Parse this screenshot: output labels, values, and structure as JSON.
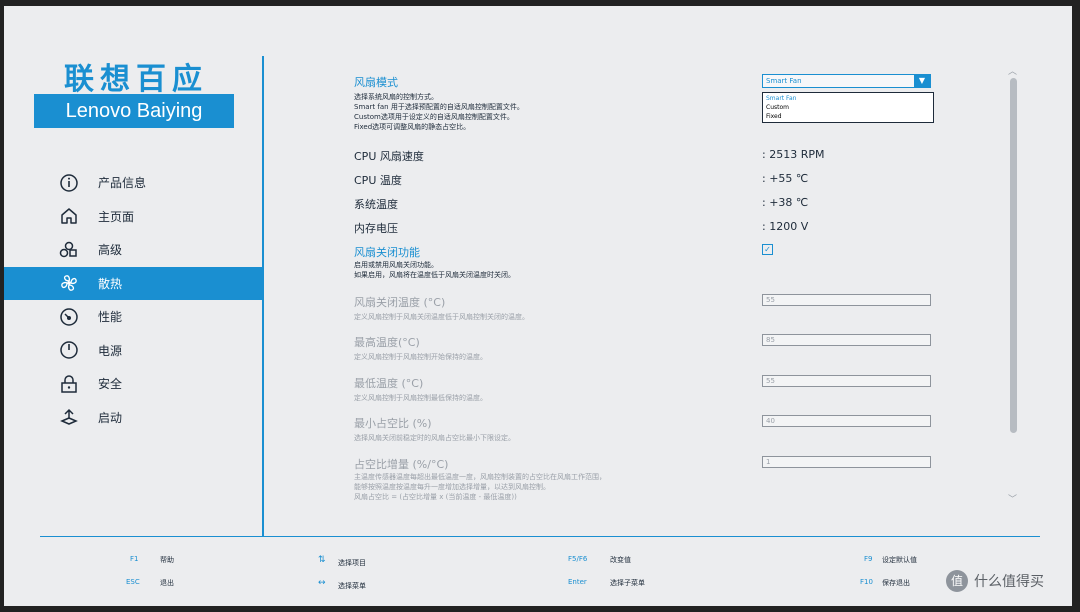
{
  "brand": {
    "cn": "联想百应",
    "en": "Lenovo Baiying"
  },
  "sidebar": {
    "items": [
      {
        "label": "产品信息",
        "icon": "info-icon"
      },
      {
        "label": "主页面",
        "icon": "home-icon"
      },
      {
        "label": "高级",
        "icon": "advanced-icon"
      },
      {
        "label": "散热",
        "icon": "fan-icon",
        "active": true
      },
      {
        "label": "性能",
        "icon": "performance-icon"
      },
      {
        "label": "电源",
        "icon": "power-icon"
      },
      {
        "label": "安全",
        "icon": "lock-icon"
      },
      {
        "label": "启动",
        "icon": "boot-icon"
      }
    ]
  },
  "main": {
    "fan_mode": {
      "label": "风扇模式",
      "desc": [
        "选择系统风扇的控制方式。",
        "Smart fan 用于选择预配置的自适风扇控制配置文件。",
        "Custom选项用于设定义的自适风扇控制配置文件。",
        "Fixed选项可调整风扇的静态占空比。"
      ],
      "selected": "Smart Fan",
      "options": [
        "Smart Fan",
        "Custom",
        "Fixed"
      ]
    },
    "cpu_fan_speed": {
      "label": "CPU 风扇速度",
      "value": ": 2513 RPM"
    },
    "cpu_temp": {
      "label": "CPU 温度",
      "value": ": +55 ℃"
    },
    "sys_temp": {
      "label": "系统温度",
      "value": ": +38 ℃"
    },
    "mem_voltage": {
      "label": "内存电压",
      "value": ": 1200 V"
    },
    "fan_off": {
      "label": "风扇关闭功能",
      "desc": [
        "启用或禁用风扇关闭功能。",
        "如果启用，风扇将在温度低于风扇关闭温度时关闭。"
      ],
      "checked": true
    },
    "fan_off_temp": {
      "label": "风扇关闭温度 (°C)",
      "desc": "定义风扇控制于风扇关闭温度低于风扇控制关闭的温度。",
      "value": "55"
    },
    "max_temp": {
      "label": "最高温度(°C)",
      "desc": "定义风扇控制于风扇控制开始保持的温度。",
      "value": "85"
    },
    "min_temp": {
      "label": "最低温度 (°C)",
      "desc": "定义风扇控制于风扇控制最低保持的温度。",
      "value": "55"
    },
    "min_duty": {
      "label": "最小占空比 (%)",
      "desc": "选择风扇关闭前稳定时的风扇占空比最小下限设定。",
      "value": "40"
    },
    "duty_step": {
      "label": "占空比增量 (%/°C)",
      "desc": [
        "主温度传感器温度每超出最低温度一度，风扇控制装置的占空比在风扇工作范围，",
        "能够按照温度按温度每升一度增加选择增量，以达到风扇控制。",
        "风扇占空比 = (占空比增量 x (当前温度 - 最低温度))"
      ],
      "value": "1"
    }
  },
  "footer": {
    "items": [
      {
        "key": "F1",
        "label": "帮助"
      },
      {
        "key": "ESC",
        "label": "退出"
      },
      {
        "key": "⇅",
        "label": "选择项目"
      },
      {
        "key": "↔",
        "label": "选择菜单"
      },
      {
        "key": "F5/F6",
        "label": "改变值"
      },
      {
        "key": "Enter",
        "label": "选择子菜单"
      },
      {
        "key": "F9",
        "label": "设定默认值"
      },
      {
        "key": "F10",
        "label": "保存退出"
      }
    ]
  },
  "watermark": {
    "symbol": "值",
    "text": "什么值得买"
  },
  "colors": {
    "accent": "#1a8fd1",
    "background": "#ecedef",
    "text": "#1e2b3a",
    "disabled": "#9aa0a8"
  }
}
